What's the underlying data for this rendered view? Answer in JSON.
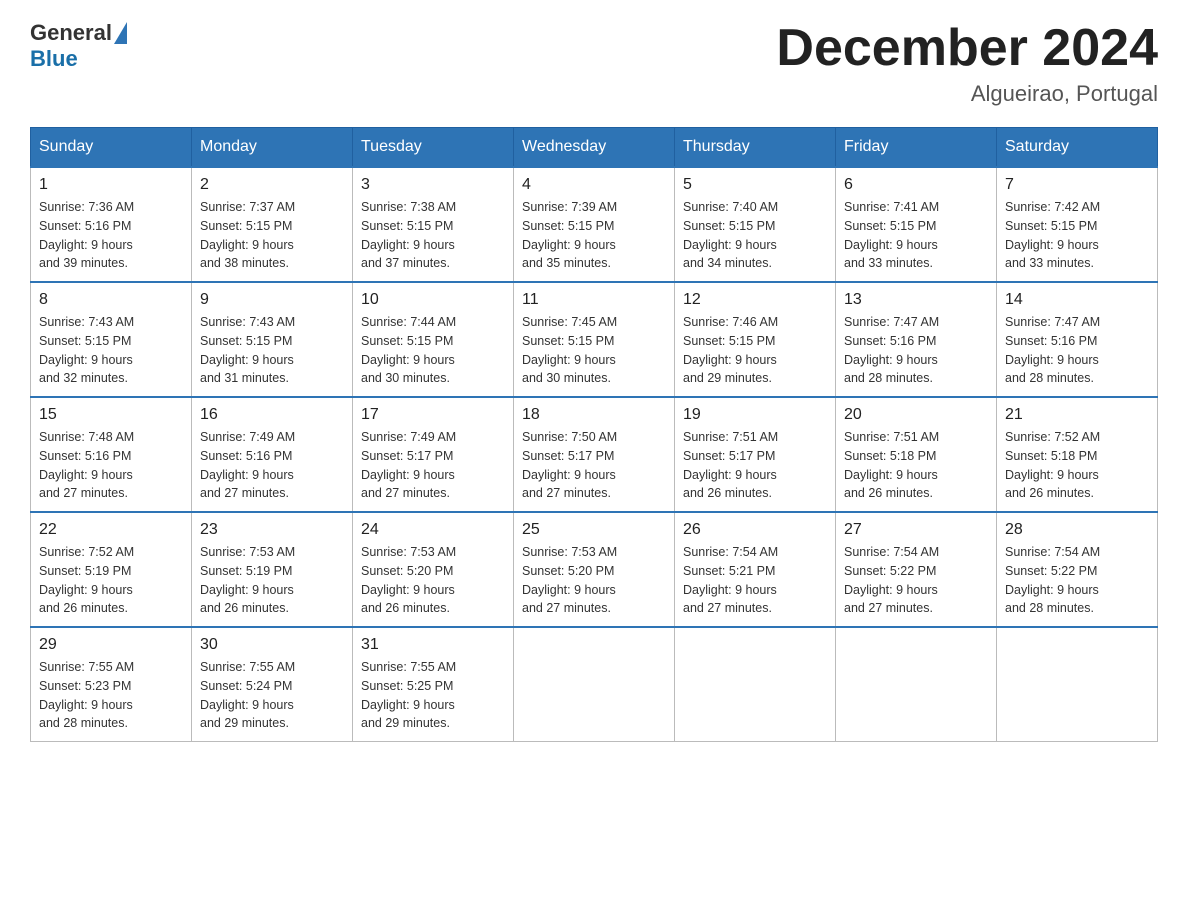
{
  "header": {
    "logo_general": "General",
    "logo_blue": "Blue",
    "title": "December 2024",
    "subtitle": "Algueirao, Portugal"
  },
  "days_of_week": [
    "Sunday",
    "Monday",
    "Tuesday",
    "Wednesday",
    "Thursday",
    "Friday",
    "Saturday"
  ],
  "weeks": [
    [
      {
        "day": "1",
        "sunrise": "7:36 AM",
        "sunset": "5:16 PM",
        "daylight": "9 hours and 39 minutes."
      },
      {
        "day": "2",
        "sunrise": "7:37 AM",
        "sunset": "5:15 PM",
        "daylight": "9 hours and 38 minutes."
      },
      {
        "day": "3",
        "sunrise": "7:38 AM",
        "sunset": "5:15 PM",
        "daylight": "9 hours and 37 minutes."
      },
      {
        "day": "4",
        "sunrise": "7:39 AM",
        "sunset": "5:15 PM",
        "daylight": "9 hours and 35 minutes."
      },
      {
        "day": "5",
        "sunrise": "7:40 AM",
        "sunset": "5:15 PM",
        "daylight": "9 hours and 34 minutes."
      },
      {
        "day": "6",
        "sunrise": "7:41 AM",
        "sunset": "5:15 PM",
        "daylight": "9 hours and 33 minutes."
      },
      {
        "day": "7",
        "sunrise": "7:42 AM",
        "sunset": "5:15 PM",
        "daylight": "9 hours and 33 minutes."
      }
    ],
    [
      {
        "day": "8",
        "sunrise": "7:43 AM",
        "sunset": "5:15 PM",
        "daylight": "9 hours and 32 minutes."
      },
      {
        "day": "9",
        "sunrise": "7:43 AM",
        "sunset": "5:15 PM",
        "daylight": "9 hours and 31 minutes."
      },
      {
        "day": "10",
        "sunrise": "7:44 AM",
        "sunset": "5:15 PM",
        "daylight": "9 hours and 30 minutes."
      },
      {
        "day": "11",
        "sunrise": "7:45 AM",
        "sunset": "5:15 PM",
        "daylight": "9 hours and 30 minutes."
      },
      {
        "day": "12",
        "sunrise": "7:46 AM",
        "sunset": "5:15 PM",
        "daylight": "9 hours and 29 minutes."
      },
      {
        "day": "13",
        "sunrise": "7:47 AM",
        "sunset": "5:16 PM",
        "daylight": "9 hours and 28 minutes."
      },
      {
        "day": "14",
        "sunrise": "7:47 AM",
        "sunset": "5:16 PM",
        "daylight": "9 hours and 28 minutes."
      }
    ],
    [
      {
        "day": "15",
        "sunrise": "7:48 AM",
        "sunset": "5:16 PM",
        "daylight": "9 hours and 27 minutes."
      },
      {
        "day": "16",
        "sunrise": "7:49 AM",
        "sunset": "5:16 PM",
        "daylight": "9 hours and 27 minutes."
      },
      {
        "day": "17",
        "sunrise": "7:49 AM",
        "sunset": "5:17 PM",
        "daylight": "9 hours and 27 minutes."
      },
      {
        "day": "18",
        "sunrise": "7:50 AM",
        "sunset": "5:17 PM",
        "daylight": "9 hours and 27 minutes."
      },
      {
        "day": "19",
        "sunrise": "7:51 AM",
        "sunset": "5:17 PM",
        "daylight": "9 hours and 26 minutes."
      },
      {
        "day": "20",
        "sunrise": "7:51 AM",
        "sunset": "5:18 PM",
        "daylight": "9 hours and 26 minutes."
      },
      {
        "day": "21",
        "sunrise": "7:52 AM",
        "sunset": "5:18 PM",
        "daylight": "9 hours and 26 minutes."
      }
    ],
    [
      {
        "day": "22",
        "sunrise": "7:52 AM",
        "sunset": "5:19 PM",
        "daylight": "9 hours and 26 minutes."
      },
      {
        "day": "23",
        "sunrise": "7:53 AM",
        "sunset": "5:19 PM",
        "daylight": "9 hours and 26 minutes."
      },
      {
        "day": "24",
        "sunrise": "7:53 AM",
        "sunset": "5:20 PM",
        "daylight": "9 hours and 26 minutes."
      },
      {
        "day": "25",
        "sunrise": "7:53 AM",
        "sunset": "5:20 PM",
        "daylight": "9 hours and 27 minutes."
      },
      {
        "day": "26",
        "sunrise": "7:54 AM",
        "sunset": "5:21 PM",
        "daylight": "9 hours and 27 minutes."
      },
      {
        "day": "27",
        "sunrise": "7:54 AM",
        "sunset": "5:22 PM",
        "daylight": "9 hours and 27 minutes."
      },
      {
        "day": "28",
        "sunrise": "7:54 AM",
        "sunset": "5:22 PM",
        "daylight": "9 hours and 28 minutes."
      }
    ],
    [
      {
        "day": "29",
        "sunrise": "7:55 AM",
        "sunset": "5:23 PM",
        "daylight": "9 hours and 28 minutes."
      },
      {
        "day": "30",
        "sunrise": "7:55 AM",
        "sunset": "5:24 PM",
        "daylight": "9 hours and 29 minutes."
      },
      {
        "day": "31",
        "sunrise": "7:55 AM",
        "sunset": "5:25 PM",
        "daylight": "9 hours and 29 minutes."
      },
      null,
      null,
      null,
      null
    ]
  ],
  "labels": {
    "sunrise_prefix": "Sunrise: ",
    "sunset_prefix": "Sunset: ",
    "daylight_prefix": "Daylight: "
  }
}
